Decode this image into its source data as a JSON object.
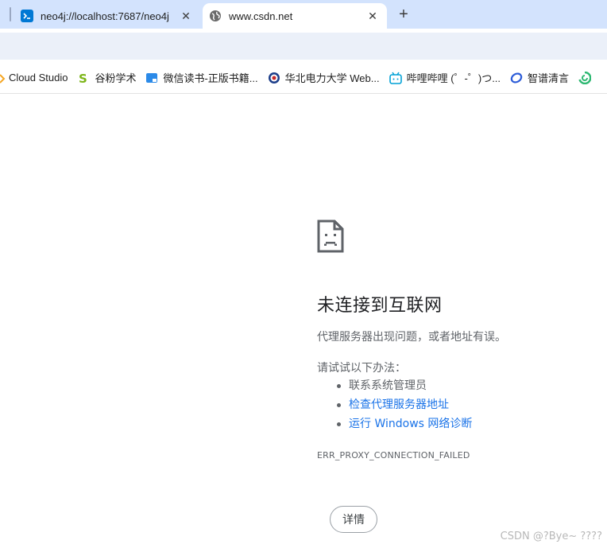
{
  "tabs": [
    {
      "title": "neo4j://localhost:7687/neo4j",
      "icon": "terminal-icon",
      "active": false
    },
    {
      "title": "www.csdn.net",
      "icon": "globe-icon",
      "active": true
    }
  ],
  "bookmarks": [
    {
      "label": "Cloud Studio",
      "icon": "cloud-studio-icon"
    },
    {
      "label": "谷粉学术",
      "icon": "gufen-s-icon"
    },
    {
      "label": "微信读书-正版书籍...",
      "icon": "weread-icon"
    },
    {
      "label": "华北电力大学 Web...",
      "icon": "ncepu-icon"
    },
    {
      "label": "哔哩哔哩 (゜-゜)つ...",
      "icon": "bilibili-icon"
    },
    {
      "label": "智谱清言",
      "icon": "zhipu-icon"
    }
  ],
  "error": {
    "title": "未连接到互联网",
    "description": "代理服务器出现问题，或者地址有误。",
    "try_label": "请试试以下办法：",
    "suggestions": [
      {
        "text": "联系系统管理员",
        "link": false
      },
      {
        "text": "检查代理服务器地址",
        "link": true
      },
      {
        "text": "运行 Windows 网络诊断",
        "link": true
      }
    ],
    "code": "ERR_PROXY_CONNECTION_FAILED",
    "details_label": "详情"
  },
  "watermark": "CSDN @?Bye~    ????",
  "colors": {
    "tabstrip": "#d3e3fd",
    "link": "#1a73e8",
    "text_secondary": "#5f6368"
  }
}
